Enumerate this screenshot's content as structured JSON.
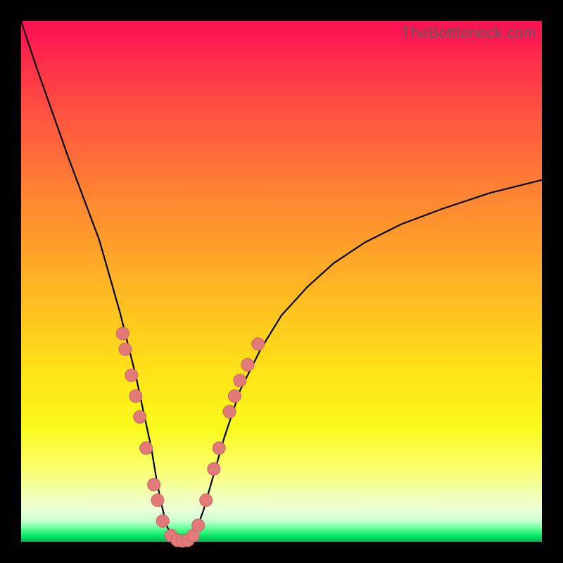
{
  "watermark": {
    "text": "TheBottleneck.com"
  },
  "colors": {
    "frame": "#000000",
    "curve": "#000000",
    "marker_fill": "#e27a7a",
    "marker_stroke": "#c86666"
  },
  "chart_data": {
    "type": "line",
    "title": "",
    "xlabel": "",
    "ylabel": "",
    "xlim": [
      0,
      100
    ],
    "ylim": [
      0,
      100
    ],
    "grid": false,
    "series": [
      {
        "name": "bottleneck-curve",
        "x": [
          0,
          3,
          6,
          9,
          12,
          15,
          17,
          19,
          20.5,
          22,
          23.5,
          25,
          26,
          27,
          28,
          29,
          30,
          31,
          32,
          33.5,
          35,
          37,
          39,
          42,
          46,
          50,
          55,
          60,
          66,
          73,
          81,
          90,
          100
        ],
        "values": [
          100,
          91,
          82.5,
          74,
          66,
          58,
          51,
          44,
          38,
          32,
          25,
          18,
          12,
          7,
          3,
          1,
          0.2,
          0,
          0.2,
          2,
          6,
          13,
          20,
          29,
          37,
          43.5,
          49,
          53.5,
          57.5,
          61,
          64,
          67,
          69.5
        ]
      }
    ],
    "markers": [
      {
        "x": 19.5,
        "y": 40
      },
      {
        "x": 20.0,
        "y": 37
      },
      {
        "x": 21.2,
        "y": 32
      },
      {
        "x": 22.0,
        "y": 28
      },
      {
        "x": 22.8,
        "y": 24
      },
      {
        "x": 24.0,
        "y": 18
      },
      {
        "x": 25.5,
        "y": 11
      },
      {
        "x": 26.2,
        "y": 8
      },
      {
        "x": 27.2,
        "y": 4
      },
      {
        "x": 28.8,
        "y": 1.2
      },
      {
        "x": 30.0,
        "y": 0.3
      },
      {
        "x": 31.0,
        "y": 0.2
      },
      {
        "x": 32.0,
        "y": 0.3
      },
      {
        "x": 33.0,
        "y": 1.2
      },
      {
        "x": 34.0,
        "y": 3.2
      },
      {
        "x": 35.5,
        "y": 8
      },
      {
        "x": 37.0,
        "y": 14
      },
      {
        "x": 38.0,
        "y": 18
      },
      {
        "x": 40.0,
        "y": 25
      },
      {
        "x": 41.0,
        "y": 28
      },
      {
        "x": 42.0,
        "y": 31
      },
      {
        "x": 43.5,
        "y": 34
      },
      {
        "x": 45.5,
        "y": 38
      }
    ]
  }
}
